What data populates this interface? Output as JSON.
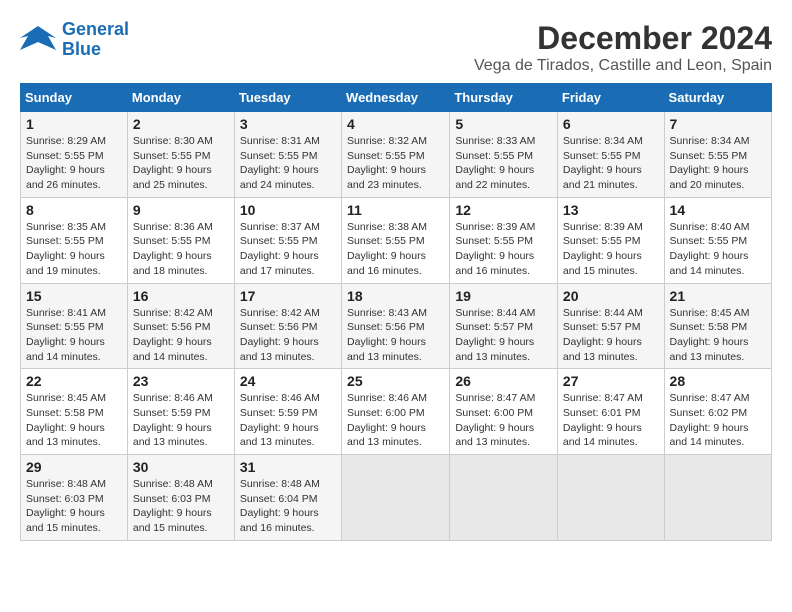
{
  "logo": {
    "text_general": "General",
    "text_blue": "Blue"
  },
  "title": "December 2024",
  "subtitle": "Vega de Tirados, Castille and Leon, Spain",
  "days_of_week": [
    "Sunday",
    "Monday",
    "Tuesday",
    "Wednesday",
    "Thursday",
    "Friday",
    "Saturday"
  ],
  "weeks": [
    [
      {
        "day": "1",
        "sunrise": "8:29 AM",
        "sunset": "5:55 PM",
        "daylight": "9 hours and 26 minutes."
      },
      {
        "day": "2",
        "sunrise": "8:30 AM",
        "sunset": "5:55 PM",
        "daylight": "9 hours and 25 minutes."
      },
      {
        "day": "3",
        "sunrise": "8:31 AM",
        "sunset": "5:55 PM",
        "daylight": "9 hours and 24 minutes."
      },
      {
        "day": "4",
        "sunrise": "8:32 AM",
        "sunset": "5:55 PM",
        "daylight": "9 hours and 23 minutes."
      },
      {
        "day": "5",
        "sunrise": "8:33 AM",
        "sunset": "5:55 PM",
        "daylight": "9 hours and 22 minutes."
      },
      {
        "day": "6",
        "sunrise": "8:34 AM",
        "sunset": "5:55 PM",
        "daylight": "9 hours and 21 minutes."
      },
      {
        "day": "7",
        "sunrise": "8:34 AM",
        "sunset": "5:55 PM",
        "daylight": "9 hours and 20 minutes."
      }
    ],
    [
      {
        "day": "8",
        "sunrise": "8:35 AM",
        "sunset": "5:55 PM",
        "daylight": "9 hours and 19 minutes."
      },
      {
        "day": "9",
        "sunrise": "8:36 AM",
        "sunset": "5:55 PM",
        "daylight": "9 hours and 18 minutes."
      },
      {
        "day": "10",
        "sunrise": "8:37 AM",
        "sunset": "5:55 PM",
        "daylight": "9 hours and 17 minutes."
      },
      {
        "day": "11",
        "sunrise": "8:38 AM",
        "sunset": "5:55 PM",
        "daylight": "9 hours and 16 minutes."
      },
      {
        "day": "12",
        "sunrise": "8:39 AM",
        "sunset": "5:55 PM",
        "daylight": "9 hours and 16 minutes."
      },
      {
        "day": "13",
        "sunrise": "8:39 AM",
        "sunset": "5:55 PM",
        "daylight": "9 hours and 15 minutes."
      },
      {
        "day": "14",
        "sunrise": "8:40 AM",
        "sunset": "5:55 PM",
        "daylight": "9 hours and 14 minutes."
      }
    ],
    [
      {
        "day": "15",
        "sunrise": "8:41 AM",
        "sunset": "5:55 PM",
        "daylight": "9 hours and 14 minutes."
      },
      {
        "day": "16",
        "sunrise": "8:42 AM",
        "sunset": "5:56 PM",
        "daylight": "9 hours and 14 minutes."
      },
      {
        "day": "17",
        "sunrise": "8:42 AM",
        "sunset": "5:56 PM",
        "daylight": "9 hours and 13 minutes."
      },
      {
        "day": "18",
        "sunrise": "8:43 AM",
        "sunset": "5:56 PM",
        "daylight": "9 hours and 13 minutes."
      },
      {
        "day": "19",
        "sunrise": "8:44 AM",
        "sunset": "5:57 PM",
        "daylight": "9 hours and 13 minutes."
      },
      {
        "day": "20",
        "sunrise": "8:44 AM",
        "sunset": "5:57 PM",
        "daylight": "9 hours and 13 minutes."
      },
      {
        "day": "21",
        "sunrise": "8:45 AM",
        "sunset": "5:58 PM",
        "daylight": "9 hours and 13 minutes."
      }
    ],
    [
      {
        "day": "22",
        "sunrise": "8:45 AM",
        "sunset": "5:58 PM",
        "daylight": "9 hours and 13 minutes."
      },
      {
        "day": "23",
        "sunrise": "8:46 AM",
        "sunset": "5:59 PM",
        "daylight": "9 hours and 13 minutes."
      },
      {
        "day": "24",
        "sunrise": "8:46 AM",
        "sunset": "5:59 PM",
        "daylight": "9 hours and 13 minutes."
      },
      {
        "day": "25",
        "sunrise": "8:46 AM",
        "sunset": "6:00 PM",
        "daylight": "9 hours and 13 minutes."
      },
      {
        "day": "26",
        "sunrise": "8:47 AM",
        "sunset": "6:00 PM",
        "daylight": "9 hours and 13 minutes."
      },
      {
        "day": "27",
        "sunrise": "8:47 AM",
        "sunset": "6:01 PM",
        "daylight": "9 hours and 14 minutes."
      },
      {
        "day": "28",
        "sunrise": "8:47 AM",
        "sunset": "6:02 PM",
        "daylight": "9 hours and 14 minutes."
      }
    ],
    [
      {
        "day": "29",
        "sunrise": "8:48 AM",
        "sunset": "6:03 PM",
        "daylight": "9 hours and 15 minutes."
      },
      {
        "day": "30",
        "sunrise": "8:48 AM",
        "sunset": "6:03 PM",
        "daylight": "9 hours and 15 minutes."
      },
      {
        "day": "31",
        "sunrise": "8:48 AM",
        "sunset": "6:04 PM",
        "daylight": "9 hours and 16 minutes."
      },
      null,
      null,
      null,
      null
    ]
  ]
}
